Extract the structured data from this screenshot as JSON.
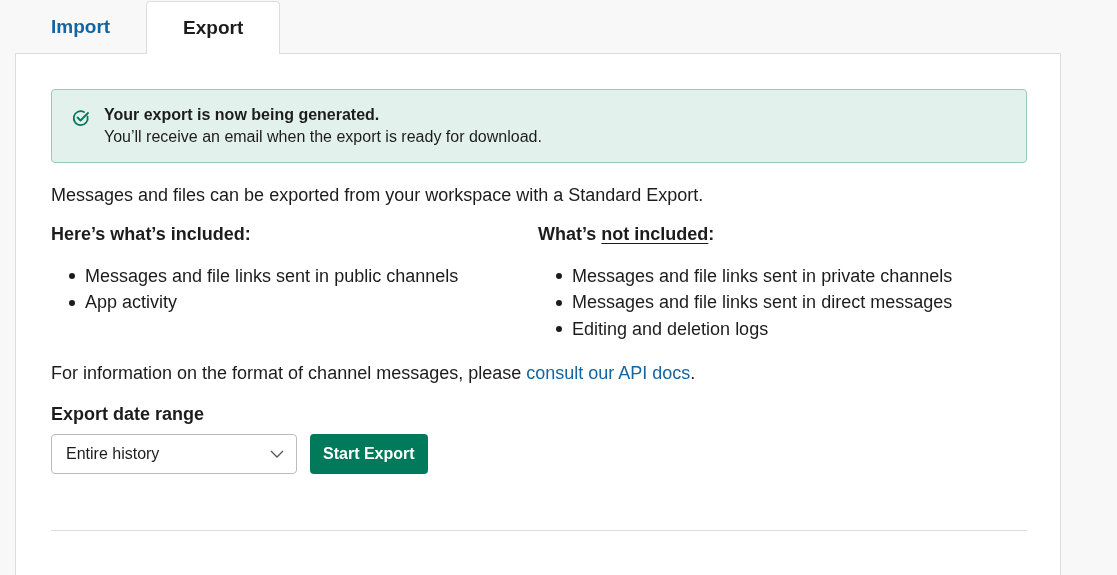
{
  "tabs": [
    {
      "label": "Import",
      "selected": false
    },
    {
      "label": "Export",
      "selected": true
    }
  ],
  "banner": {
    "title": "Your export is now being generated.",
    "message": "You’ll receive an email when the export is ready for download."
  },
  "intro": "Messages and files can be exported from your workspace with a Standard Export.",
  "included": {
    "heading": "Here’s what’s included:",
    "items": [
      "Messages and file links sent in public channels",
      "App activity"
    ]
  },
  "not_included": {
    "heading_start": "What’s ",
    "heading_underlined": "not included",
    "heading_end": ":",
    "items": [
      "Messages and file links sent in private channels",
      "Messages and file links sent in direct messages",
      "Editing and deletion logs"
    ]
  },
  "info": {
    "text": "For information on the format of channel messages, please ",
    "link": "consult our API docs",
    "end": "."
  },
  "date_range": {
    "label": "Export date range",
    "value": "Entire history"
  },
  "button": "Start Export"
}
